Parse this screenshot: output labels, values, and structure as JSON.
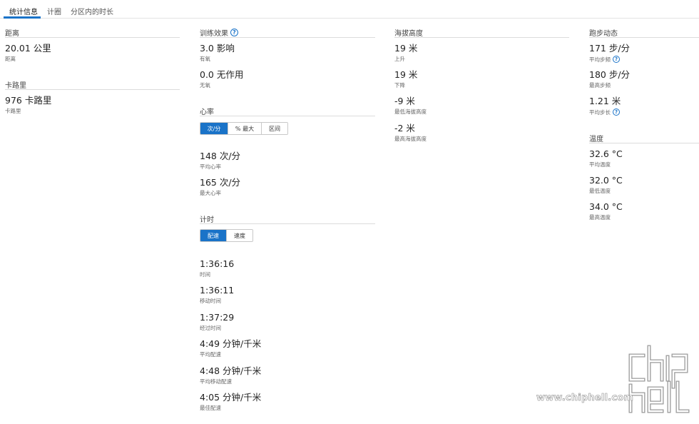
{
  "tabs": [
    {
      "label": "统计信息",
      "active": true
    },
    {
      "label": "计圈",
      "active": false
    },
    {
      "label": "分区内的时长",
      "active": false
    }
  ],
  "distance": {
    "title": "距离",
    "stats": [
      {
        "value": "20.01 公里",
        "label": "距离"
      }
    ]
  },
  "calories": {
    "title": "卡路里",
    "stats": [
      {
        "value": "976 卡路里",
        "label": "卡路里"
      }
    ]
  },
  "training_effect": {
    "title": "训练效果",
    "help_icon": "?",
    "stats": [
      {
        "value": "3.0 影响",
        "label": "有氧"
      },
      {
        "value": "0.0 无作用",
        "label": "无氧"
      }
    ]
  },
  "heart_rate": {
    "title": "心率",
    "toggle": [
      "次/分",
      "% 最大",
      "区间"
    ],
    "stats": [
      {
        "value": "148 次/分",
        "label": "平均心率"
      },
      {
        "value": "165 次/分",
        "label": "最大心率"
      }
    ]
  },
  "timing": {
    "title": "计时",
    "toggle": [
      "配速",
      "速度"
    ],
    "stats": [
      {
        "value": "1:36:16",
        "label": "时间"
      },
      {
        "value": "1:36:11",
        "label": "移动时间"
      },
      {
        "value": "1:37:29",
        "label": "经过时间"
      },
      {
        "value": "4:49 分钟/千米",
        "label": "平均配速"
      },
      {
        "value": "4:48 分钟/千米",
        "label": "平均移动配速"
      },
      {
        "value": "4:05 分钟/千米",
        "label": "最佳配速"
      }
    ]
  },
  "elevation": {
    "title": "海拔高度",
    "stats": [
      {
        "value": "19 米",
        "label": "上升"
      },
      {
        "value": "19 米",
        "label": "下降"
      },
      {
        "value": "-9 米",
        "label": "最低海拔高度"
      },
      {
        "value": "-2 米",
        "label": "最高海拔高度"
      }
    ]
  },
  "running_dynamics": {
    "title": "跑步动态",
    "stats": [
      {
        "value": "171 步/分",
        "label": "平均步频"
      },
      {
        "value": "180 步/分",
        "label": "最高步频"
      },
      {
        "value": "1.21 米",
        "label": "平均步长"
      }
    ]
  },
  "temperature": {
    "title": "温度",
    "stats": [
      {
        "value": "32.6 °C",
        "label": "平均温度"
      },
      {
        "value": "32.0 °C",
        "label": "最低温度"
      },
      {
        "value": "34.0 °C",
        "label": "最高温度"
      }
    ]
  },
  "watermark": {
    "text": "www.chiphell.com"
  },
  "colors": {
    "accent": "#1a73c8",
    "text": "#222222",
    "muted": "#666666",
    "divider": "#dcdcdc"
  }
}
